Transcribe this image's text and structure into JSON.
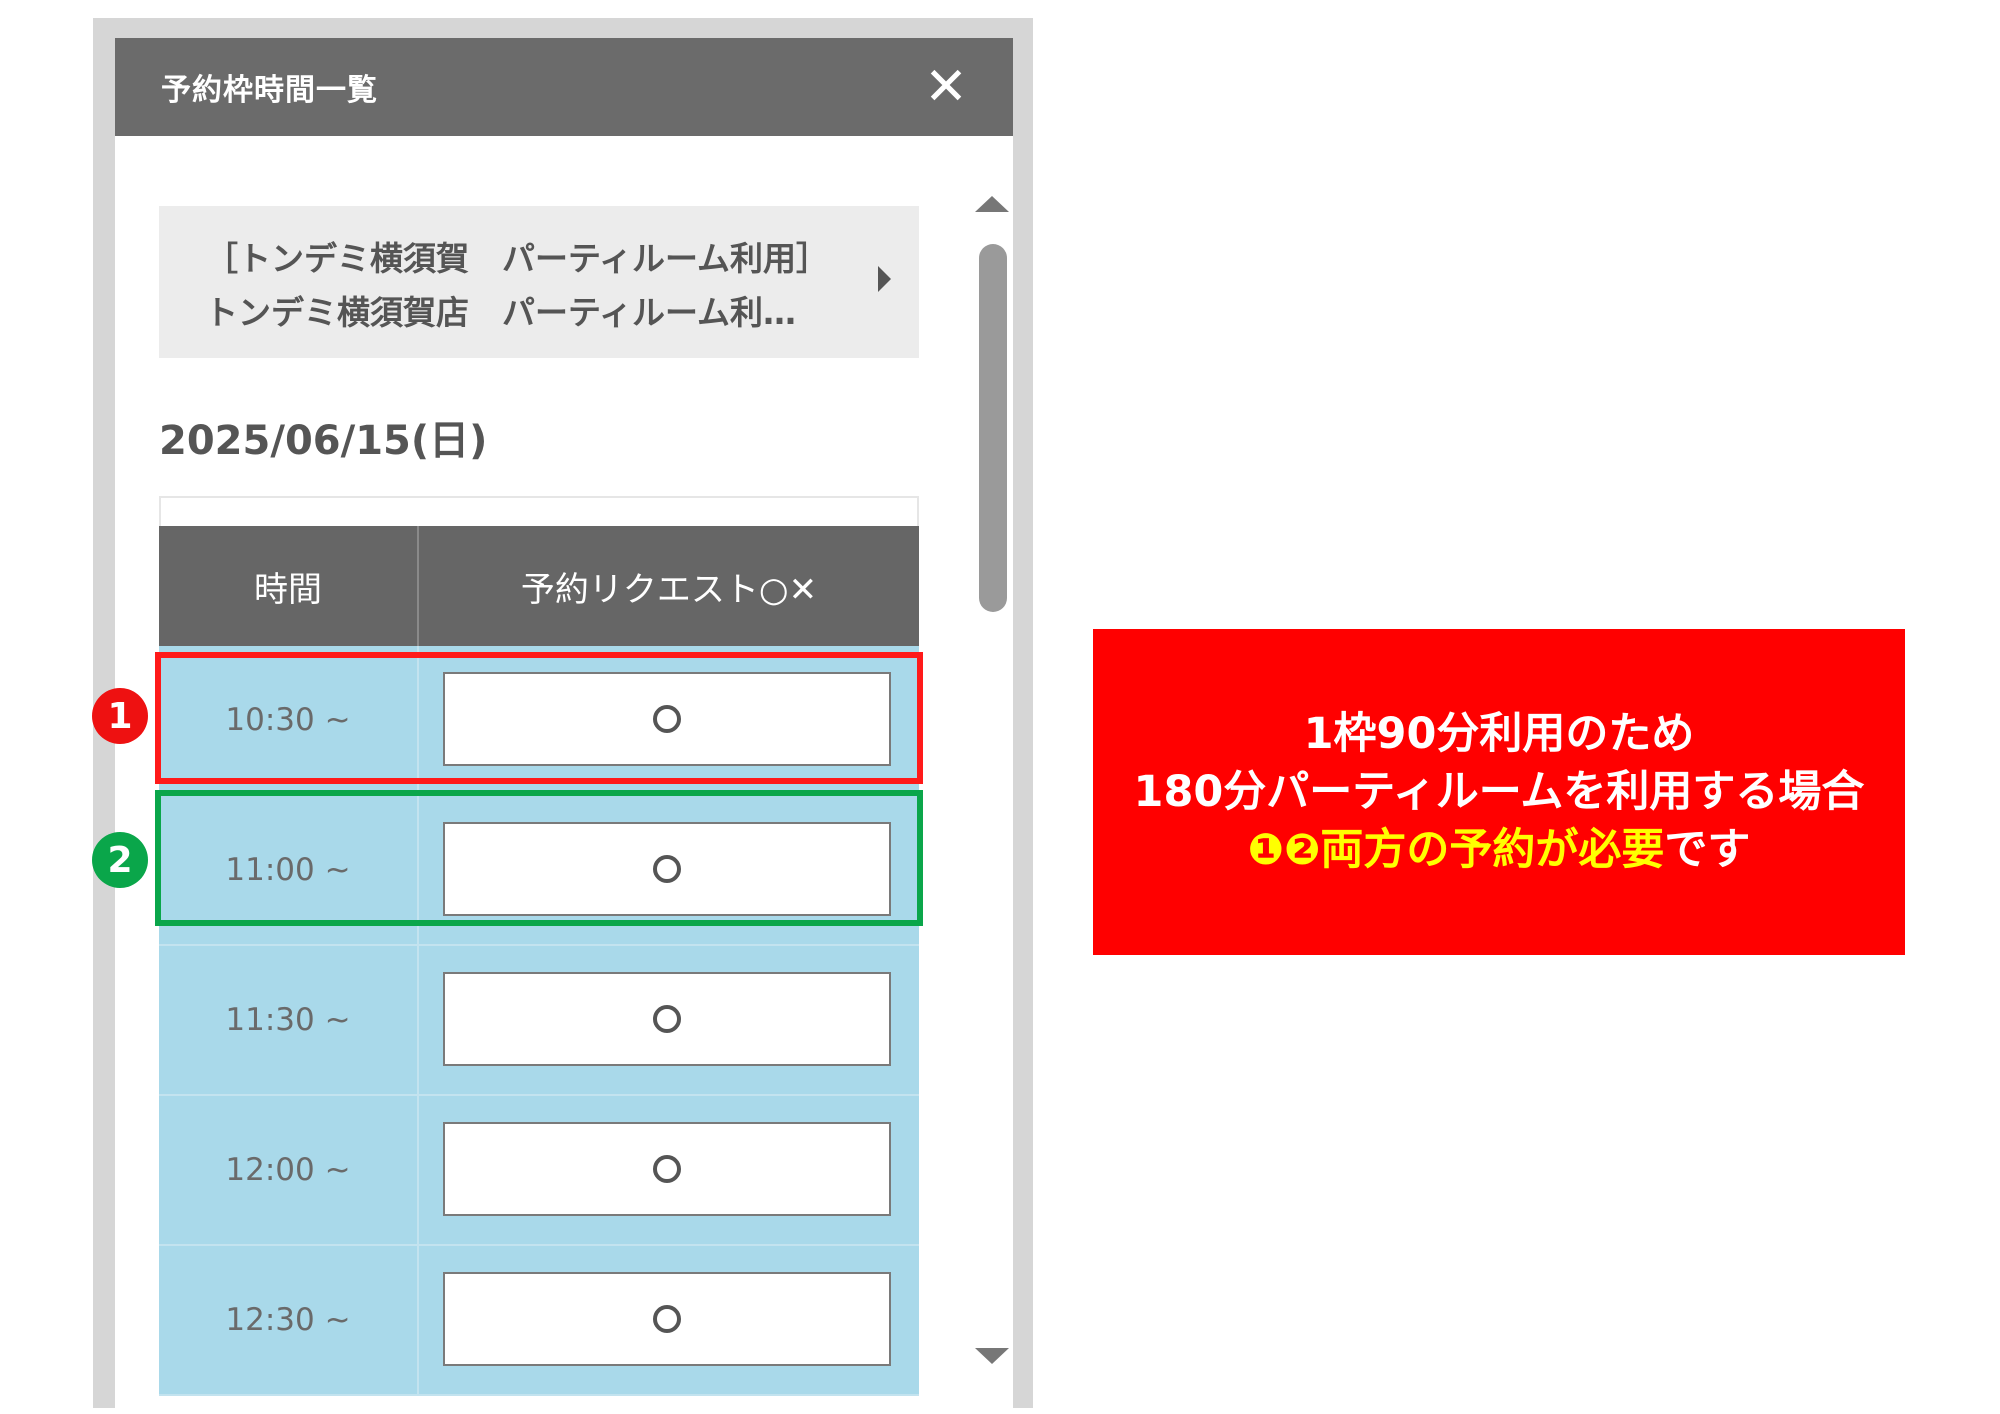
{
  "modal": {
    "title": "予約枠時間一覧",
    "close_label": "✕"
  },
  "store": {
    "line1": "［トンデミ横須賀　パーティルーム利用］",
    "line2": "トンデミ横須賀店　パーティルーム利…"
  },
  "date": "2025/06/15(日)",
  "table": {
    "headers": {
      "time": "時間",
      "request": "予約リクエスト○✕"
    },
    "rows": [
      {
        "time": "10:30 ~",
        "status": "available"
      },
      {
        "time": "11:00 ~",
        "status": "available"
      },
      {
        "time": "11:30 ~",
        "status": "available"
      },
      {
        "time": "12:00 ~",
        "status": "available"
      },
      {
        "time": "12:30 ~",
        "status": "available"
      }
    ]
  },
  "annotations": {
    "badge1": "1",
    "badge2": "2",
    "callout_line1": "1枠90分利用のため",
    "callout_line2": "180分パーティルームを利用する場合",
    "callout_line3_highlight": "❶❷両方の予約が必要",
    "callout_line3_rest": "です"
  },
  "colors": {
    "header_bg": "#6b6b6b",
    "row_bg": "#a9d9ea",
    "highlight_red": "#ff1a1a",
    "highlight_green": "#0aa64a",
    "callout_bg": "#ff0000",
    "callout_highlight_text": "#ffff00"
  }
}
